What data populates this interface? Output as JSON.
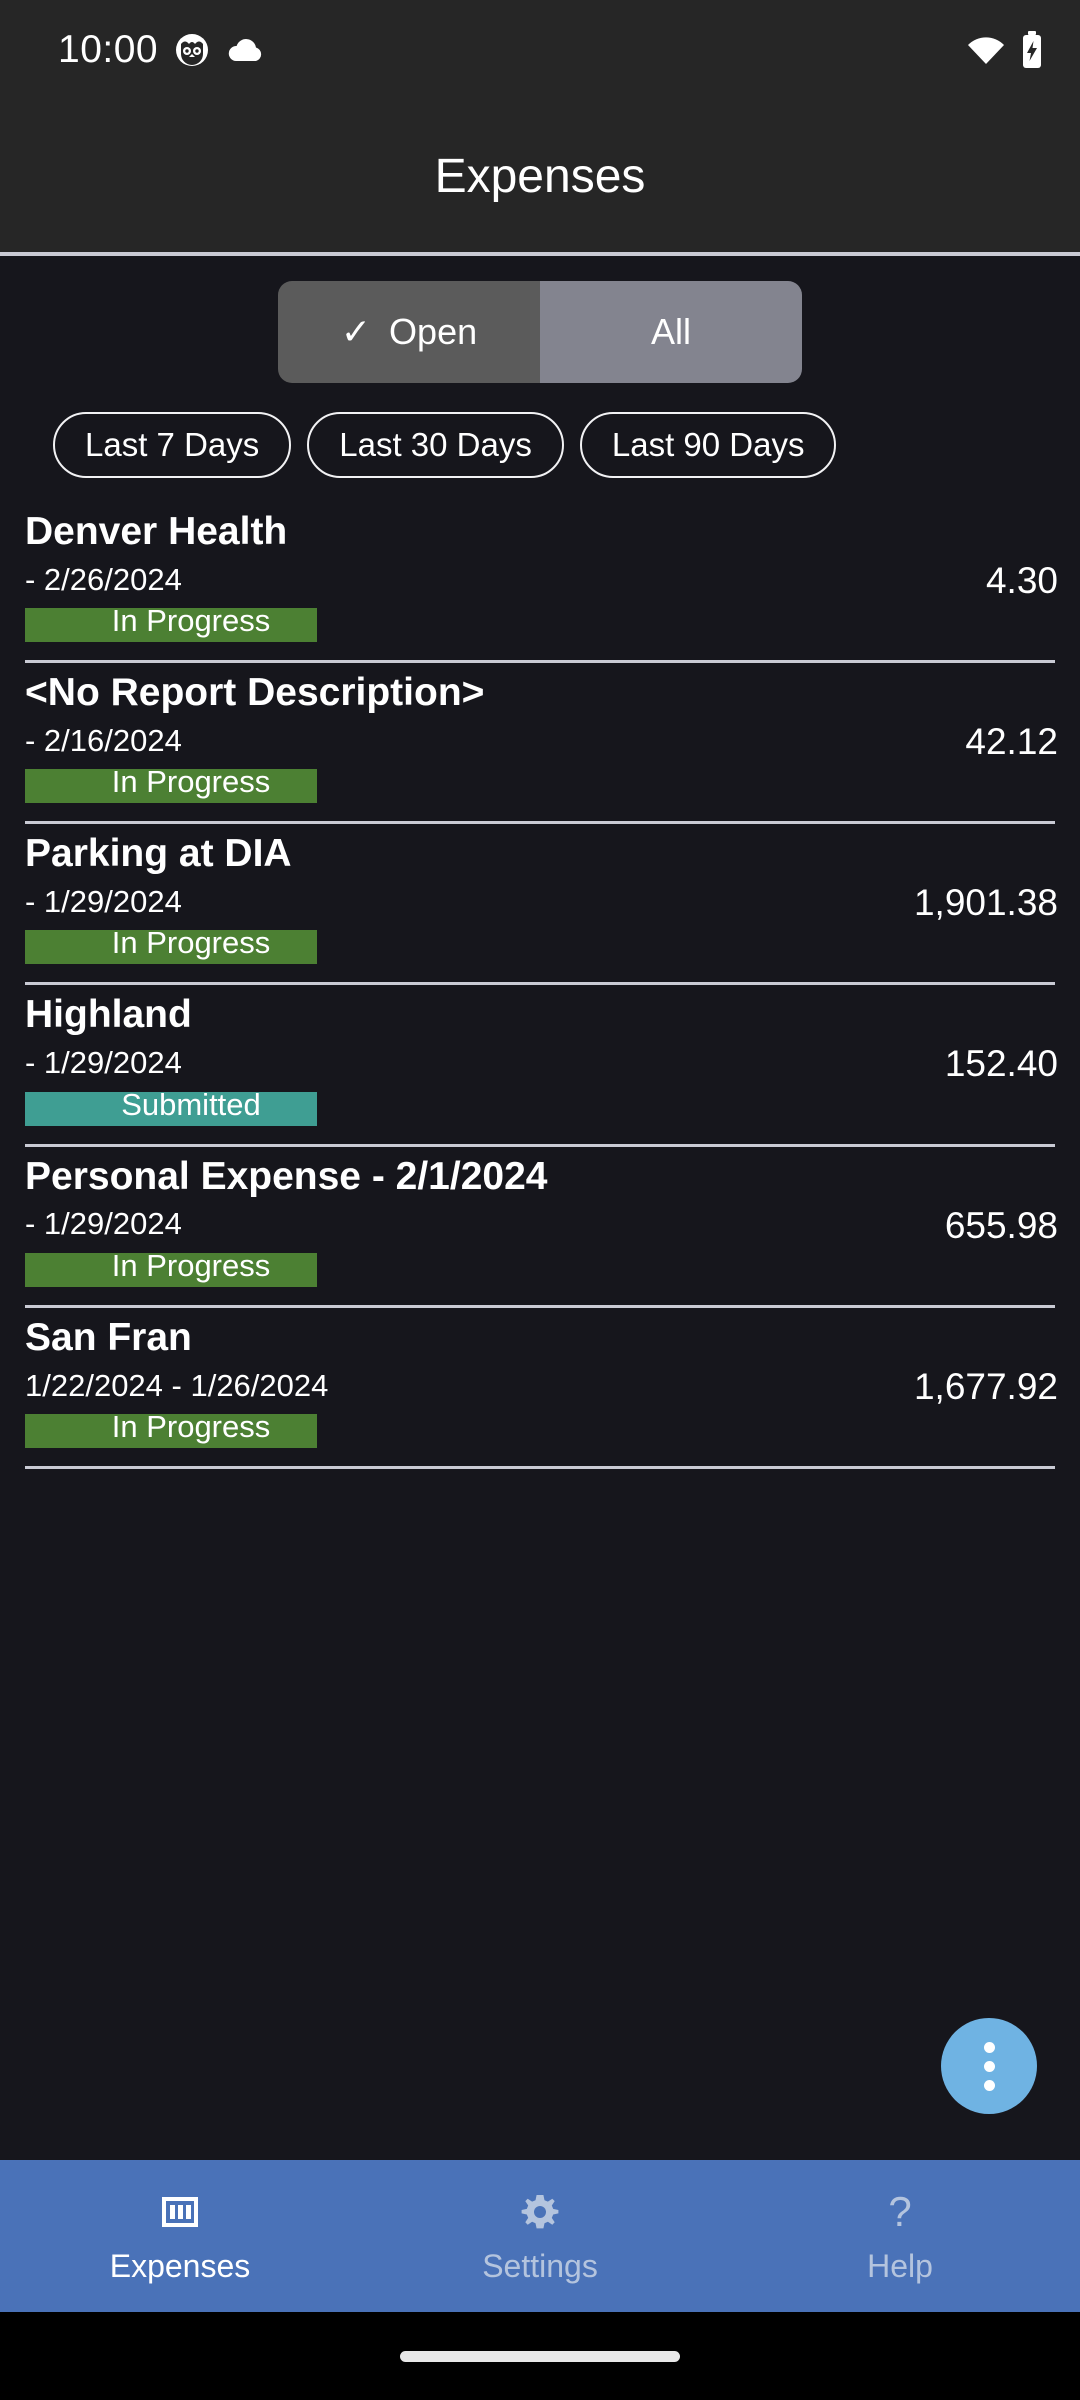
{
  "status_bar": {
    "time": "10:00",
    "left_icons": [
      "owl-icon",
      "cloud-icon"
    ],
    "right_icons": [
      "wifi-icon",
      "battery-charging-icon"
    ]
  },
  "header": {
    "title": "Expenses"
  },
  "filters": {
    "segmented": {
      "options": [
        {
          "label": "Open",
          "selected": true,
          "check": "✓"
        },
        {
          "label": "All",
          "selected": false
        }
      ]
    },
    "chips": [
      {
        "label": "Last 7 Days"
      },
      {
        "label": "Last 30 Days"
      },
      {
        "label": "Last 90 Days"
      }
    ]
  },
  "colors": {
    "in_progress": "#4c8033",
    "submitted": "#3f9e93",
    "accent_fab": "#6fb3e3",
    "nav_bar": "#4a72b8",
    "app_bar": "#262626",
    "background": "#16161c"
  },
  "expenses": [
    {
      "title": "Denver Health",
      "date": "- 2/26/2024",
      "status": "In Progress",
      "status_color": "#4c8033",
      "amount": "4.30"
    },
    {
      "title": "<No Report Description>",
      "date": "- 2/16/2024",
      "status": "In Progress",
      "status_color": "#4c8033",
      "amount": "42.12"
    },
    {
      "title": "Parking at DIA",
      "date": "- 1/29/2024",
      "status": "In Progress",
      "status_color": "#4c8033",
      "amount": "1,901.38"
    },
    {
      "title": "Highland",
      "date": "- 1/29/2024",
      "status": "Submitted",
      "status_color": "#3f9e93",
      "amount": "152.40"
    },
    {
      "title": "Personal Expense - 2/1/2024",
      "date": "- 1/29/2024",
      "status": "In Progress",
      "status_color": "#4c8033",
      "amount": "655.98"
    },
    {
      "title": "San Fran",
      "date": "1/22/2024 - 1/26/2024",
      "status": "In Progress",
      "status_color": "#4c8033",
      "amount": "1,677.92"
    }
  ],
  "fab": {
    "icon": "more-vertical-icon"
  },
  "bottom_nav": [
    {
      "label": "Expenses",
      "icon": "banknote-100-icon",
      "active": true
    },
    {
      "label": "Settings",
      "icon": "gear-icon",
      "active": false
    },
    {
      "label": "Help",
      "icon": "question-mark-icon",
      "active": false
    }
  ]
}
